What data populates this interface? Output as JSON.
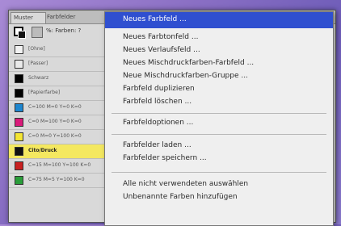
{
  "tabs": [
    "Muster",
    "Farbfelder"
  ],
  "toolbar": {
    "text": "%: Farben: ?"
  },
  "swatches": [
    {
      "name": "[Ohne]",
      "color": "#f2f2f2",
      "highlight": false
    },
    {
      "name": "[Passer]",
      "color": "#e9e9e9",
      "highlight": false
    },
    {
      "name": "Schwarz",
      "color": "#000000",
      "highlight": false
    },
    {
      "name": "[Papierfarbe]",
      "color": "#ffffff",
      "highlight": false
    },
    {
      "name": "C=100 M=0 Y=0 K=0",
      "color": "#1e86cf",
      "highlight": false
    },
    {
      "name": "C=0 M=100 Y=0 K=0",
      "color": "#d91a7a",
      "highlight": false
    },
    {
      "name": "C=0 M=0 Y=100 K=0",
      "color": "#f4e534",
      "highlight": false
    },
    {
      "name": "Cito/Druck",
      "color": "#111111",
      "highlight": true
    },
    {
      "name": "C=15 M=100 Y=100 K=0",
      "color": "#c82020",
      "highlight": false
    },
    {
      "name": "C=75 M=5 Y=100 K=0",
      "color": "#2a9d3a",
      "highlight": false
    }
  ],
  "menu": {
    "items": [
      "Neues Farbfeld ...",
      "Neues Farbtonfeld ...",
      "Neues Verlaufsfeld ...",
      "Neues Mischdruckfarben-Farbfeld ...",
      "Neue Mischdruckfarben-Gruppe ...",
      "Farbfeld duplizieren",
      "Farbfeld löschen ...",
      "Farbfeldoptionen ...",
      "Farbfelder laden ...",
      "Farbfelder speichern ...",
      "Alle nicht verwendeten auswählen",
      "Unbenannte Farben hinzufügen"
    ]
  }
}
